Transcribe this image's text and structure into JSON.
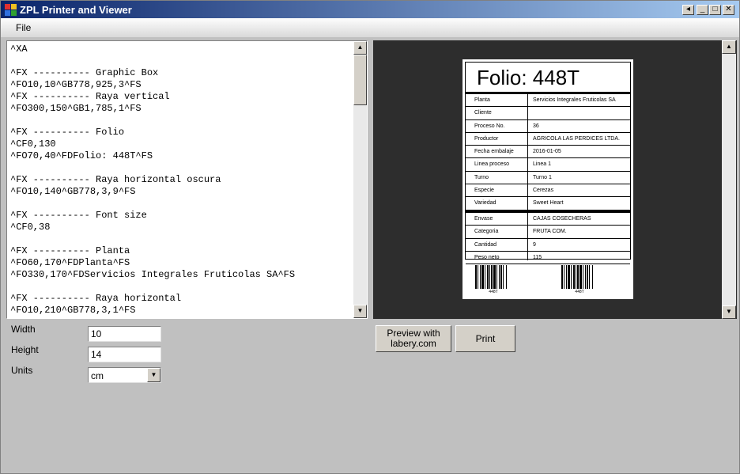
{
  "window": {
    "title": "ZPL Printer and Viewer"
  },
  "titlebar_buttons": {
    "restore": "◂",
    "minimize": "_",
    "maximize": "□",
    "close": "✕"
  },
  "menu": {
    "file": "File"
  },
  "editor": {
    "lines": [
      "^XA",
      "",
      "^FX ---------- Graphic Box",
      "^FO10,10^GB778,925,3^FS",
      "^FX ---------- Raya vertical",
      "^FO300,150^GB1,785,1^FS",
      "",
      "^FX ---------- Folio",
      "^CF0,130",
      "^FO70,40^FDFolio: 448T^FS",
      "",
      "^FX ---------- Raya horizontal oscura",
      "^FO10,140^GB778,3,9^FS",
      "",
      "^FX ---------- Font size",
      "^CF0,38",
      "",
      "^FX ---------- Planta",
      "^FO60,170^FDPlanta^FS",
      "^FO330,170^FDServicios Integrales Fruticolas SA^FS",
      "",
      "^FX ---------- Raya horizontal",
      "^FO10,210^GB778,3,1^FS"
    ]
  },
  "form": {
    "width_label": "Width",
    "width_value": "10",
    "height_label": "Height",
    "height_value": "14",
    "units_label": "Units",
    "units_value": "cm"
  },
  "preview": {
    "folio": "Folio: 448T",
    "rows_top": [
      {
        "k": "Planta",
        "v": "Servicios Integrales Fruticolas SA"
      },
      {
        "k": "Cliente",
        "v": ""
      },
      {
        "k": "Proceso No.",
        "v": "36"
      },
      {
        "k": "Productor",
        "v": "AGRICOLA LAS PERDICES LTDA."
      },
      {
        "k": "Fecha embalaje",
        "v": "2016-01-05"
      },
      {
        "k": "Linea proceso",
        "v": "Linea 1"
      },
      {
        "k": "Turno",
        "v": "Turno 1"
      },
      {
        "k": "Especie",
        "v": "Cerezas"
      },
      {
        "k": "Variedad",
        "v": "Sweet Heart"
      }
    ],
    "rows_bottom": [
      {
        "k": "Envase",
        "v": "CAJAS COSECHERAS"
      },
      {
        "k": "Categoria",
        "v": "FRUTA COM."
      },
      {
        "k": "Cantidad",
        "v": "9"
      },
      {
        "k": "Peso neto",
        "v": "115"
      }
    ],
    "barcode_1": "448T",
    "barcode_2": "448T"
  },
  "buttons": {
    "preview": "Preview with labery.com",
    "print": "Print"
  }
}
